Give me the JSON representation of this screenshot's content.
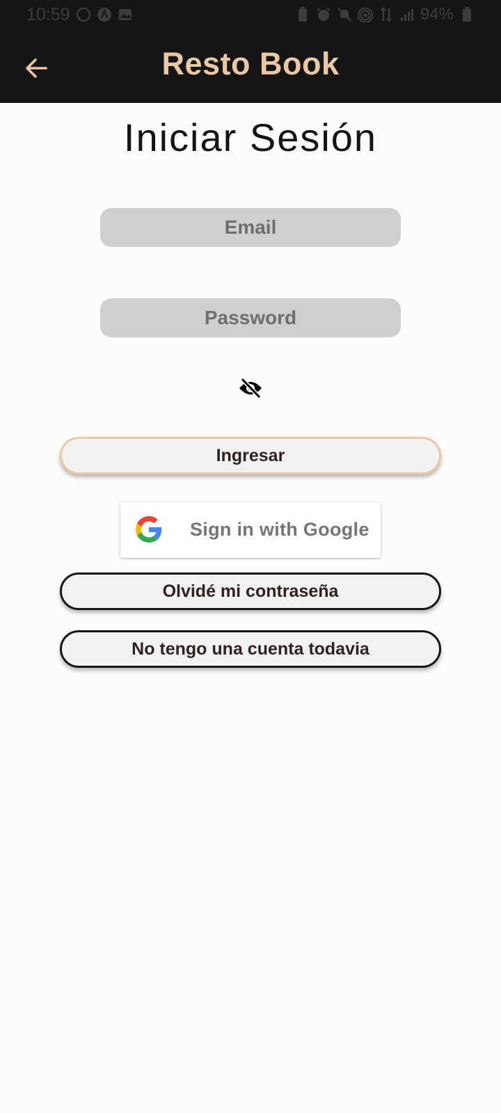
{
  "status_bar": {
    "time": "10:59",
    "battery": "94%",
    "left_icons": [
      "whatsapp-icon",
      "app-icon",
      "image-icon"
    ],
    "right_icons": [
      "battery-saver-icon",
      "alarm-icon",
      "mute-icon",
      "hotspot-icon",
      "data-icon",
      "signal-icon"
    ]
  },
  "app_bar": {
    "title": "Resto Book",
    "back_icon": "arrow-left-icon",
    "title_color": "#e9c9a3"
  },
  "page": {
    "title": "Iniciar Sesión"
  },
  "form": {
    "email_placeholder": "Email",
    "email_value": "",
    "password_placeholder": "Password",
    "password_value": "",
    "visibility_icon": "eye-off-icon"
  },
  "buttons": {
    "login_label": "Ingresar",
    "google_label": "Sign in with Google",
    "forgot_label": "Olvidé mi contraseña",
    "signup_label": "No tengo una cuenta todavia"
  },
  "colors": {
    "accent": "#e9c9a3",
    "bar_background": "#151515",
    "field_background": "#cfcfcf"
  }
}
